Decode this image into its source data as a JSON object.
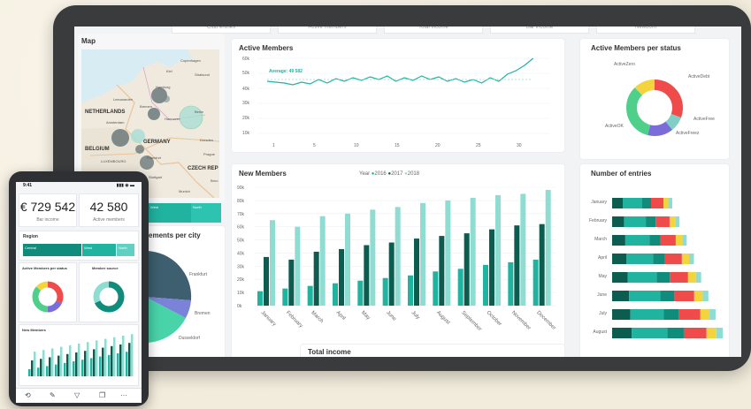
{
  "tablet": {
    "top_tabs": [
      "Club entries",
      "Active members",
      "Total income",
      "Bar income",
      "Newborn"
    ],
    "map": {
      "title": "Map",
      "labels": [
        "Copenhagen",
        "NETHERLANDS",
        "Amsterdam",
        "GERMANY",
        "BELGIUM",
        "LUXEMBOURG",
        "Stuttgart",
        "Munich",
        "CZECH REP",
        "Leeuwarden",
        "Bremen",
        "Hamburg",
        "Hannover",
        "Berlin",
        "Frankfurt",
        "Dresden",
        "Prague",
        "Stralsund",
        "Kiel",
        "Brno"
      ]
    },
    "active_members": {
      "title": "Active Members",
      "average_label": "Average: 49 582",
      "y_ticks": [
        "60k",
        "50k",
        "40k",
        "30k",
        "20k",
        "10k"
      ],
      "x_ticks": [
        "1",
        "5",
        "10",
        "15",
        "20",
        "25",
        "30"
      ]
    },
    "status": {
      "title": "Active Members per status",
      "labels": [
        "ActiveZero",
        "ActiveDebt",
        "ActiveFree",
        "ActiveFreez",
        "ActiveOK"
      ]
    },
    "new_members": {
      "title": "New Members",
      "legend_title": "Year",
      "legend": [
        "2016",
        "2017",
        "2018"
      ],
      "colors": [
        "#1fb3a0",
        "#0d5c50",
        "#8fddd2"
      ]
    },
    "entries": {
      "title": "Number of entries",
      "months": [
        "January",
        "February",
        "March",
        "April",
        "May",
        "June",
        "July",
        "August"
      ]
    },
    "city": {
      "title": "ements per city",
      "labels": [
        "Frankfurt",
        "Bremen",
        "Dusseldorf"
      ],
      "region_labels": [
        "West",
        "North"
      ]
    },
    "total_income": {
      "title": "Total income"
    }
  },
  "chart_data": {
    "type": "bar",
    "title": "New Members",
    "categories": [
      "January",
      "February",
      "March",
      "April",
      "May",
      "June",
      "July",
      "August",
      "September",
      "October",
      "November",
      "December"
    ],
    "series": [
      {
        "name": "2016",
        "values": [
          11,
          13,
          15,
          17,
          19,
          21,
          23,
          26,
          28,
          31,
          33,
          35
        ]
      },
      {
        "name": "2017",
        "values": [
          37,
          35,
          41,
          43,
          46,
          48,
          51,
          53,
          55,
          58,
          61,
          62
        ]
      },
      {
        "name": "2018",
        "values": [
          65,
          60,
          68,
          70,
          73,
          75,
          78,
          80,
          82,
          84,
          85,
          88
        ]
      }
    ],
    "y_ticks": [
      "90k",
      "80k",
      "70k",
      "60k",
      "50k",
      "40k",
      "30k",
      "20k",
      "10k",
      "0k"
    ],
    "ylim": [
      0,
      90
    ]
  },
  "phone": {
    "time": "9:41",
    "kpis": [
      {
        "value": "€ 729 542",
        "label": "Bar income"
      },
      {
        "value": "42 580",
        "label": "Active members"
      }
    ],
    "region": {
      "title": "Region",
      "tabs": [
        "Central",
        "West",
        "North"
      ]
    },
    "status_title": "Active Members per status",
    "source_title": "Member source",
    "new_members_title": "New Members",
    "toolbar": [
      "⟲",
      "✎",
      "▽",
      "❐",
      "···"
    ]
  }
}
